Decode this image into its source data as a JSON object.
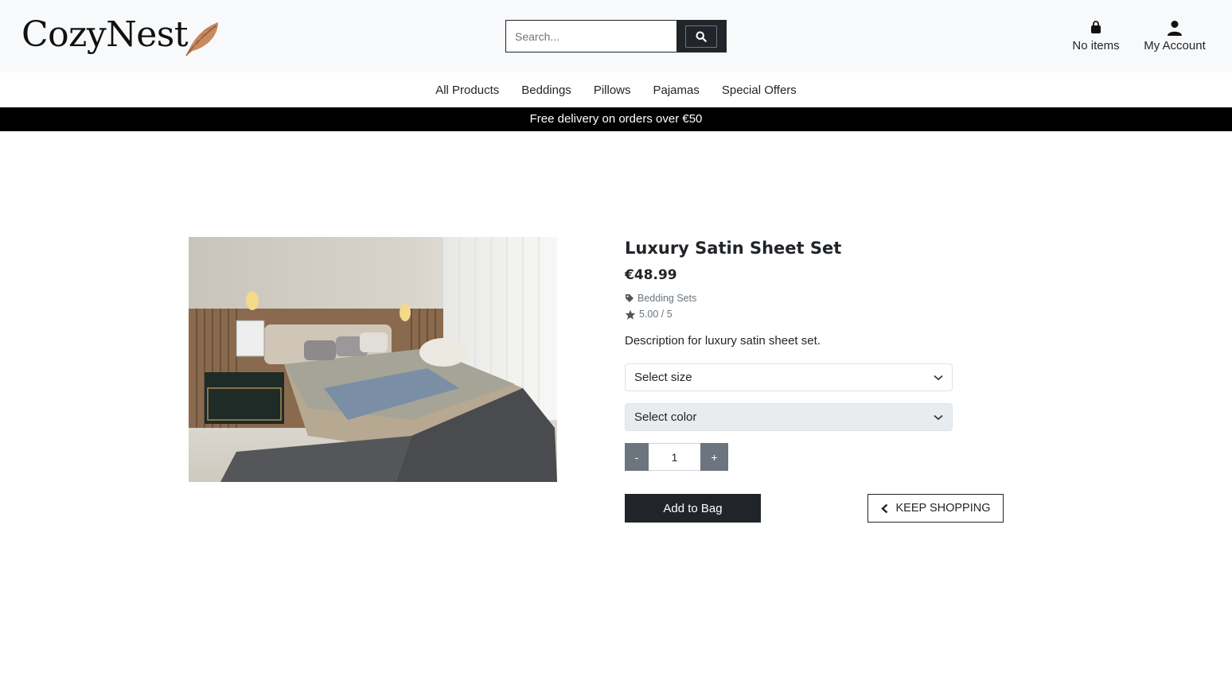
{
  "brand": {
    "name": "CozyNest",
    "logo_icon": "feather-icon"
  },
  "search": {
    "placeholder": "Search...",
    "button_icon": "search-icon"
  },
  "header": {
    "bag": {
      "icon": "shopping-bag-icon",
      "label": "No items"
    },
    "account": {
      "icon": "user-icon",
      "label": "My Account"
    }
  },
  "nav": {
    "items": [
      {
        "label": "All Products"
      },
      {
        "label": "Beddings"
      },
      {
        "label": "Pillows"
      },
      {
        "label": "Pajamas"
      },
      {
        "label": "Special Offers"
      }
    ]
  },
  "banner": {
    "text": "Free delivery on orders over €50"
  },
  "product": {
    "image_icon": "bedroom-photo",
    "title": "Luxury Satin Sheet Set",
    "price": "€48.99",
    "category": {
      "icon": "tag-icon",
      "label": "Bedding Sets"
    },
    "rating": {
      "icon": "star-icon",
      "label": "5.00 / 5"
    },
    "description": "Description for luxury satin sheet set.",
    "size_select": {
      "value": "Select size"
    },
    "color_select": {
      "value": "Select color"
    },
    "quantity": {
      "value": "1",
      "minus": "-",
      "plus": "+"
    },
    "add_to_bag": "Add to Bag",
    "keep_shopping": "KEEP SHOPPING"
  },
  "colors": {
    "dark": "#212529",
    "banner": "#000000",
    "header_bg": "#f8f9fa",
    "qty_btn": "#6c757d"
  }
}
